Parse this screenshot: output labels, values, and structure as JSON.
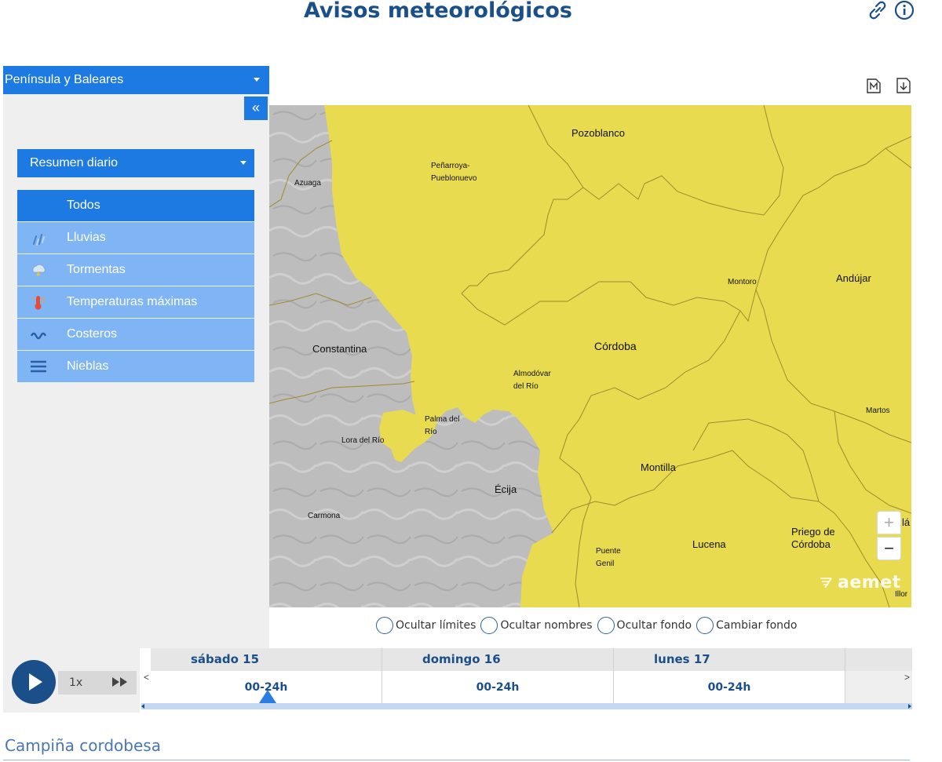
{
  "header": {
    "title": "Avisos meteorológicos",
    "icons": [
      "link-icon",
      "info-icon"
    ]
  },
  "sidebar": {
    "region": "Península y Baleares",
    "collapse_glyph": "«",
    "view": "Resumen diario",
    "categories": [
      {
        "label": "Todos",
        "active": true,
        "icon": ""
      },
      {
        "label": "Lluvias",
        "active": false,
        "icon": "rain-icon"
      },
      {
        "label": "Tormentas",
        "active": false,
        "icon": "storm-icon"
      },
      {
        "label": "Temperaturas máximas",
        "active": false,
        "icon": "thermometer-icon"
      },
      {
        "label": "Costeros",
        "active": false,
        "icon": "waves-icon"
      },
      {
        "label": "Nieblas",
        "active": false,
        "icon": "fog-icon"
      }
    ]
  },
  "map_tools": [
    "map-letter-icon",
    "download-icon"
  ],
  "map": {
    "colors": {
      "warning_yellow": "#e8db4f",
      "no_warning_gray": "#bdbdbd",
      "border": "#a08a2e"
    },
    "places": [
      "Pozoblanco",
      "Peñarroya-\nPueblonuevo",
      "Azuaga",
      "Montoro",
      "Andújar",
      "Constantina",
      "Córdoba",
      "Almodóvar\ndel Río",
      "Martos",
      "Palma del\nRío",
      "Lora del Río",
      "Montilla",
      "Écija",
      "Carmona",
      "Priego de\nCórdoba",
      "Lucena",
      "Puente\nGenil",
      "Illor",
      "Alcalá"
    ],
    "place_alcala": "lá",
    "zoom_in": "+",
    "zoom_out": "−",
    "logo": "aemet"
  },
  "options": {
    "hide_limits": "Ocultar límites",
    "hide_names": "Ocultar nombres",
    "hide_background": "Ocultar fondo",
    "change_background": "Cambiar fondo"
  },
  "timeline": {
    "speed": "1x",
    "prev": "<",
    "next": ">",
    "days": [
      {
        "label": "sábado 15",
        "slot": "00-24h"
      },
      {
        "label": "domingo 16",
        "slot": "00-24h"
      },
      {
        "label": "lunes 17",
        "slot": "00-24h"
      }
    ]
  },
  "zone": {
    "name": "Campiña cordobesa"
  }
}
